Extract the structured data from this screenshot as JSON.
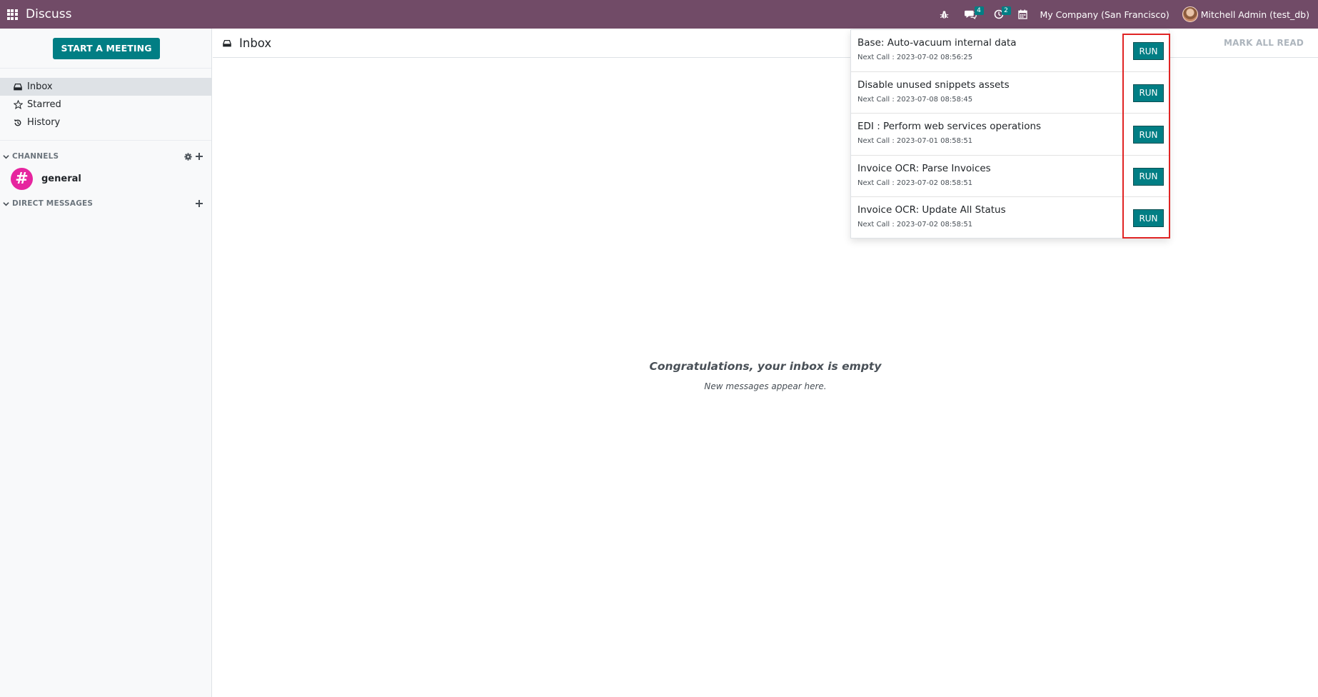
{
  "navbar": {
    "app_name": "Discuss",
    "messages_count": "4",
    "activities_count": "2",
    "company": "My Company (San Francisco)",
    "user": "Mitchell Admin (test_db)",
    "icons": [
      "apps-grid-icon",
      "bug-icon",
      "chat-icon",
      "clock-icon",
      "calendar-icon"
    ]
  },
  "sidebar": {
    "start_meeting_label": "START A MEETING",
    "mailboxes": [
      {
        "label": "Inbox",
        "icon": "inbox-icon",
        "active": true
      },
      {
        "label": "Starred",
        "icon": "star-icon",
        "active": false
      },
      {
        "label": "History",
        "icon": "history-icon",
        "active": false
      }
    ],
    "channels_label": "CHANNELS",
    "channels": [
      {
        "label": "general",
        "avatar_glyph": "#",
        "avatar_color": "#e6259f"
      }
    ],
    "direct_messages_label": "DIRECT MESSAGES"
  },
  "main": {
    "title": "Inbox",
    "mark_all_read_label": "MARK ALL READ",
    "empty_title": "Congratulations, your inbox is empty",
    "empty_subtitle": "New messages appear here."
  },
  "cron_dropdown": {
    "items": [
      {
        "name": "Base: Auto-vacuum internal data",
        "next_call": "Next Call : 2023-07-02 08:56:25",
        "run_label": "RUN"
      },
      {
        "name": "Disable unused snippets assets",
        "next_call": "Next Call : 2023-07-08 08:58:45",
        "run_label": "RUN"
      },
      {
        "name": "EDI : Perform web services operations",
        "next_call": "Next Call : 2023-07-01 08:58:51",
        "run_label": "RUN"
      },
      {
        "name": "Invoice OCR: Parse Invoices",
        "next_call": "Next Call : 2023-07-02 08:58:51",
        "run_label": "RUN"
      },
      {
        "name": "Invoice OCR: Update All Status",
        "next_call": "Next Call : 2023-07-02 08:58:51",
        "run_label": "RUN"
      }
    ]
  },
  "colors": {
    "navbar": "#714B67",
    "primary": "#017e84",
    "highlight": "#e02424"
  }
}
